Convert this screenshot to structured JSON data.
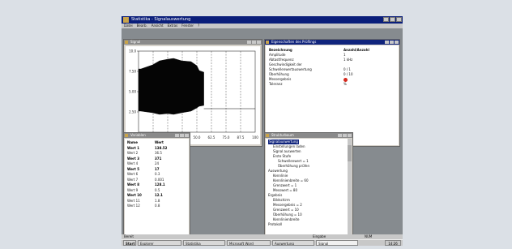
{
  "app": {
    "title": "Statistika - Signalauswertung",
    "menu": [
      "Datei",
      "Bearb.",
      "Ansicht",
      "Extras",
      "Fenster",
      "?"
    ]
  },
  "windows": {
    "chart": {
      "title": "Signal"
    },
    "props": {
      "title": "Eigenschaften des Prüflings"
    },
    "vars": {
      "title": "Variablen"
    },
    "tree": {
      "title": "Strukturbaum"
    }
  },
  "chart_data": {
    "type": "area",
    "title": "",
    "xlabel": "",
    "ylabel": "",
    "y_ticks": [
      "10.0",
      "7.50",
      "5.00",
      "2.50"
    ],
    "x_ticks": [
      "0.00",
      "12.5",
      "25.0",
      "37.5",
      "50.0",
      "62.5",
      "75.0",
      "87.5",
      "100"
    ],
    "xlim": [
      0,
      100
    ],
    "ylim": [
      0,
      10
    ],
    "grid": "vertical",
    "envelope": {
      "x": [
        0,
        2,
        12,
        18,
        25,
        30,
        37,
        45,
        50,
        52,
        56
      ],
      "upper": [
        7.8,
        7.8,
        8.3,
        8.8,
        9.0,
        9.1,
        8.8,
        8.7,
        8.2,
        7.6,
        7.4
      ],
      "lower": [
        2.6,
        2.6,
        2.4,
        2.2,
        2.3,
        2.2,
        2.4,
        2.6,
        3.0,
        3.2,
        3.3
      ]
    },
    "baseline": {
      "y": 2.9,
      "from": 56,
      "to": 100
    },
    "colors": {
      "signal": "#050505",
      "background": "#ffffff",
      "grid": "#555555"
    }
  },
  "props": {
    "rows": [
      {
        "k": "Bezeichnung",
        "v": "Anzahl/Anzahl",
        "hdr": true
      },
      {
        "k": "Amplitude",
        "v": "1"
      },
      {
        "k": "Abtastfrequenz",
        "v": "1 kHz"
      },
      {
        "k": "Geschwindigkeit der",
        "v": ""
      },
      {
        "k": "Schwellenwertauswertung",
        "v": "0 / 1"
      },
      {
        "k": "Überhöhung",
        "v": "0 / 10"
      },
      {
        "k": "Messergebnis",
        "v": "dot"
      },
      {
        "k": "Toleranz",
        "v": "%"
      }
    ]
  },
  "vars": {
    "rows": [
      {
        "k": "Name",
        "v": "Wert",
        "hl": true
      },
      {
        "k": "Wert 1",
        "v": "138.52",
        "hl": true
      },
      {
        "k": "Wert 2",
        "v": "36.5"
      },
      {
        "k": "Wert 3",
        "v": "371",
        "hl": true
      },
      {
        "k": "Wert 4",
        "v": "24"
      },
      {
        "k": "Wert 5",
        "v": "17",
        "hl": true
      },
      {
        "k": "Wert 6",
        "v": "0.3"
      },
      {
        "k": "Wert 7",
        "v": "0.001"
      },
      {
        "k": "Wert 8",
        "v": "128.1",
        "hl": true
      },
      {
        "k": "Wert 9",
        "v": "0.5"
      },
      {
        "k": "Wert 10",
        "v": "12.1",
        "hl": true
      },
      {
        "k": "Wert 11",
        "v": "1.8"
      },
      {
        "k": "Wert 12",
        "v": "0.8"
      }
    ]
  },
  "tree": {
    "nodes": [
      {
        "label": "Signalauswertung",
        "indent": 0,
        "sel": true
      },
      {
        "label": "Einstellungen laden",
        "indent": 1
      },
      {
        "label": "Signal auswerten",
        "indent": 1
      },
      {
        "label": "Erste Stufe",
        "indent": 1
      },
      {
        "label": "Schwellenwert = 1",
        "indent": 2
      },
      {
        "label": "Überhöhung prüfen",
        "indent": 2
      },
      {
        "label": "Auswertung",
        "indent": 0
      },
      {
        "label": "Kennlinie",
        "indent": 1
      },
      {
        "label": "Kennlinienbreite = 60",
        "indent": 1
      },
      {
        "label": "Grenzwert = 1",
        "indent": 1
      },
      {
        "label": "Messwert = 80",
        "indent": 1
      },
      {
        "label": "Ergebnis",
        "indent": 0
      },
      {
        "label": "Bildschirm",
        "indent": 1
      },
      {
        "label": "Messergebnis = 2",
        "indent": 1
      },
      {
        "label": "Grenzwert = 10",
        "indent": 1
      },
      {
        "label": "Überhöhung = 10",
        "indent": 1
      },
      {
        "label": "Kennlinienbreite",
        "indent": 1
      },
      {
        "label": "Protokoll",
        "indent": 0
      }
    ]
  },
  "status": {
    "left": "Bereit",
    "middle": "Eingabe",
    "right": "NUM"
  },
  "taskbar": {
    "start": "Start",
    "buttons": [
      "Explorer",
      "Statistika",
      "Microsoft Word",
      "Auswertung",
      "Signal"
    ],
    "clock": "14:26"
  }
}
